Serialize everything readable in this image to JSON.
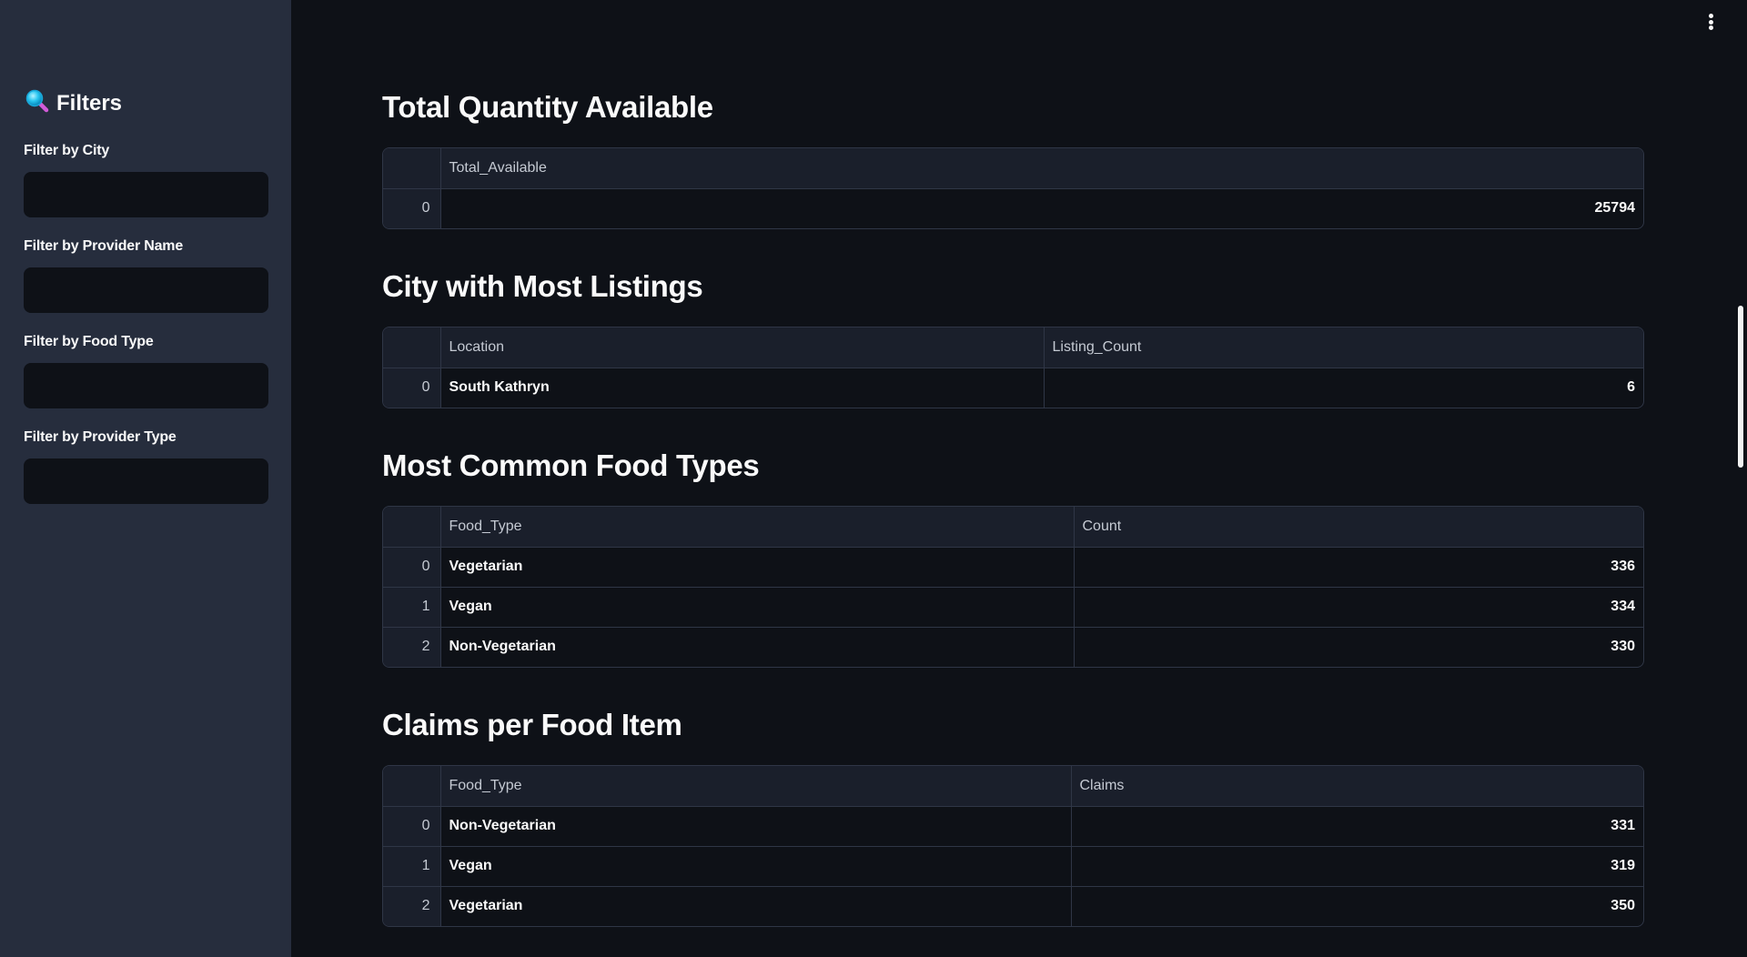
{
  "sidebar": {
    "title": "Filters",
    "icon": "magnifying-glass-icon",
    "filters": [
      {
        "label": "Filter by City",
        "value": ""
      },
      {
        "label": "Filter by Provider Name",
        "value": ""
      },
      {
        "label": "Filter by Food Type",
        "value": ""
      },
      {
        "label": "Filter by Provider Type",
        "value": ""
      }
    ]
  },
  "sections": [
    {
      "title": "Total Quantity Available",
      "columns": [
        "Total_Available"
      ],
      "rows": [
        {
          "index": "0",
          "cells": [
            "25794"
          ]
        }
      ]
    },
    {
      "title": "City with Most Listings",
      "columns": [
        "Location",
        "Listing_Count"
      ],
      "rows": [
        {
          "index": "0",
          "cells": [
            "South Kathryn",
            "6"
          ]
        }
      ]
    },
    {
      "title": "Most Common Food Types",
      "columns": [
        "Food_Type",
        "Count"
      ],
      "rows": [
        {
          "index": "0",
          "cells": [
            "Vegetarian",
            "336"
          ]
        },
        {
          "index": "1",
          "cells": [
            "Vegan",
            "334"
          ]
        },
        {
          "index": "2",
          "cells": [
            "Non-Vegetarian",
            "330"
          ]
        }
      ]
    },
    {
      "title": "Claims per Food Item",
      "columns": [
        "Food_Type",
        "Claims"
      ],
      "rows": [
        {
          "index": "0",
          "cells": [
            "Non-Vegetarian",
            "331"
          ]
        },
        {
          "index": "1",
          "cells": [
            "Vegan",
            "319"
          ]
        },
        {
          "index": "2",
          "cells": [
            "Vegetarian",
            "350"
          ]
        }
      ]
    }
  ],
  "colors": {
    "background": "#0e1117",
    "sidebar": "#262d3d",
    "table_header": "#1a1f2b",
    "border": "#2f3646",
    "text": "#fafafa"
  }
}
